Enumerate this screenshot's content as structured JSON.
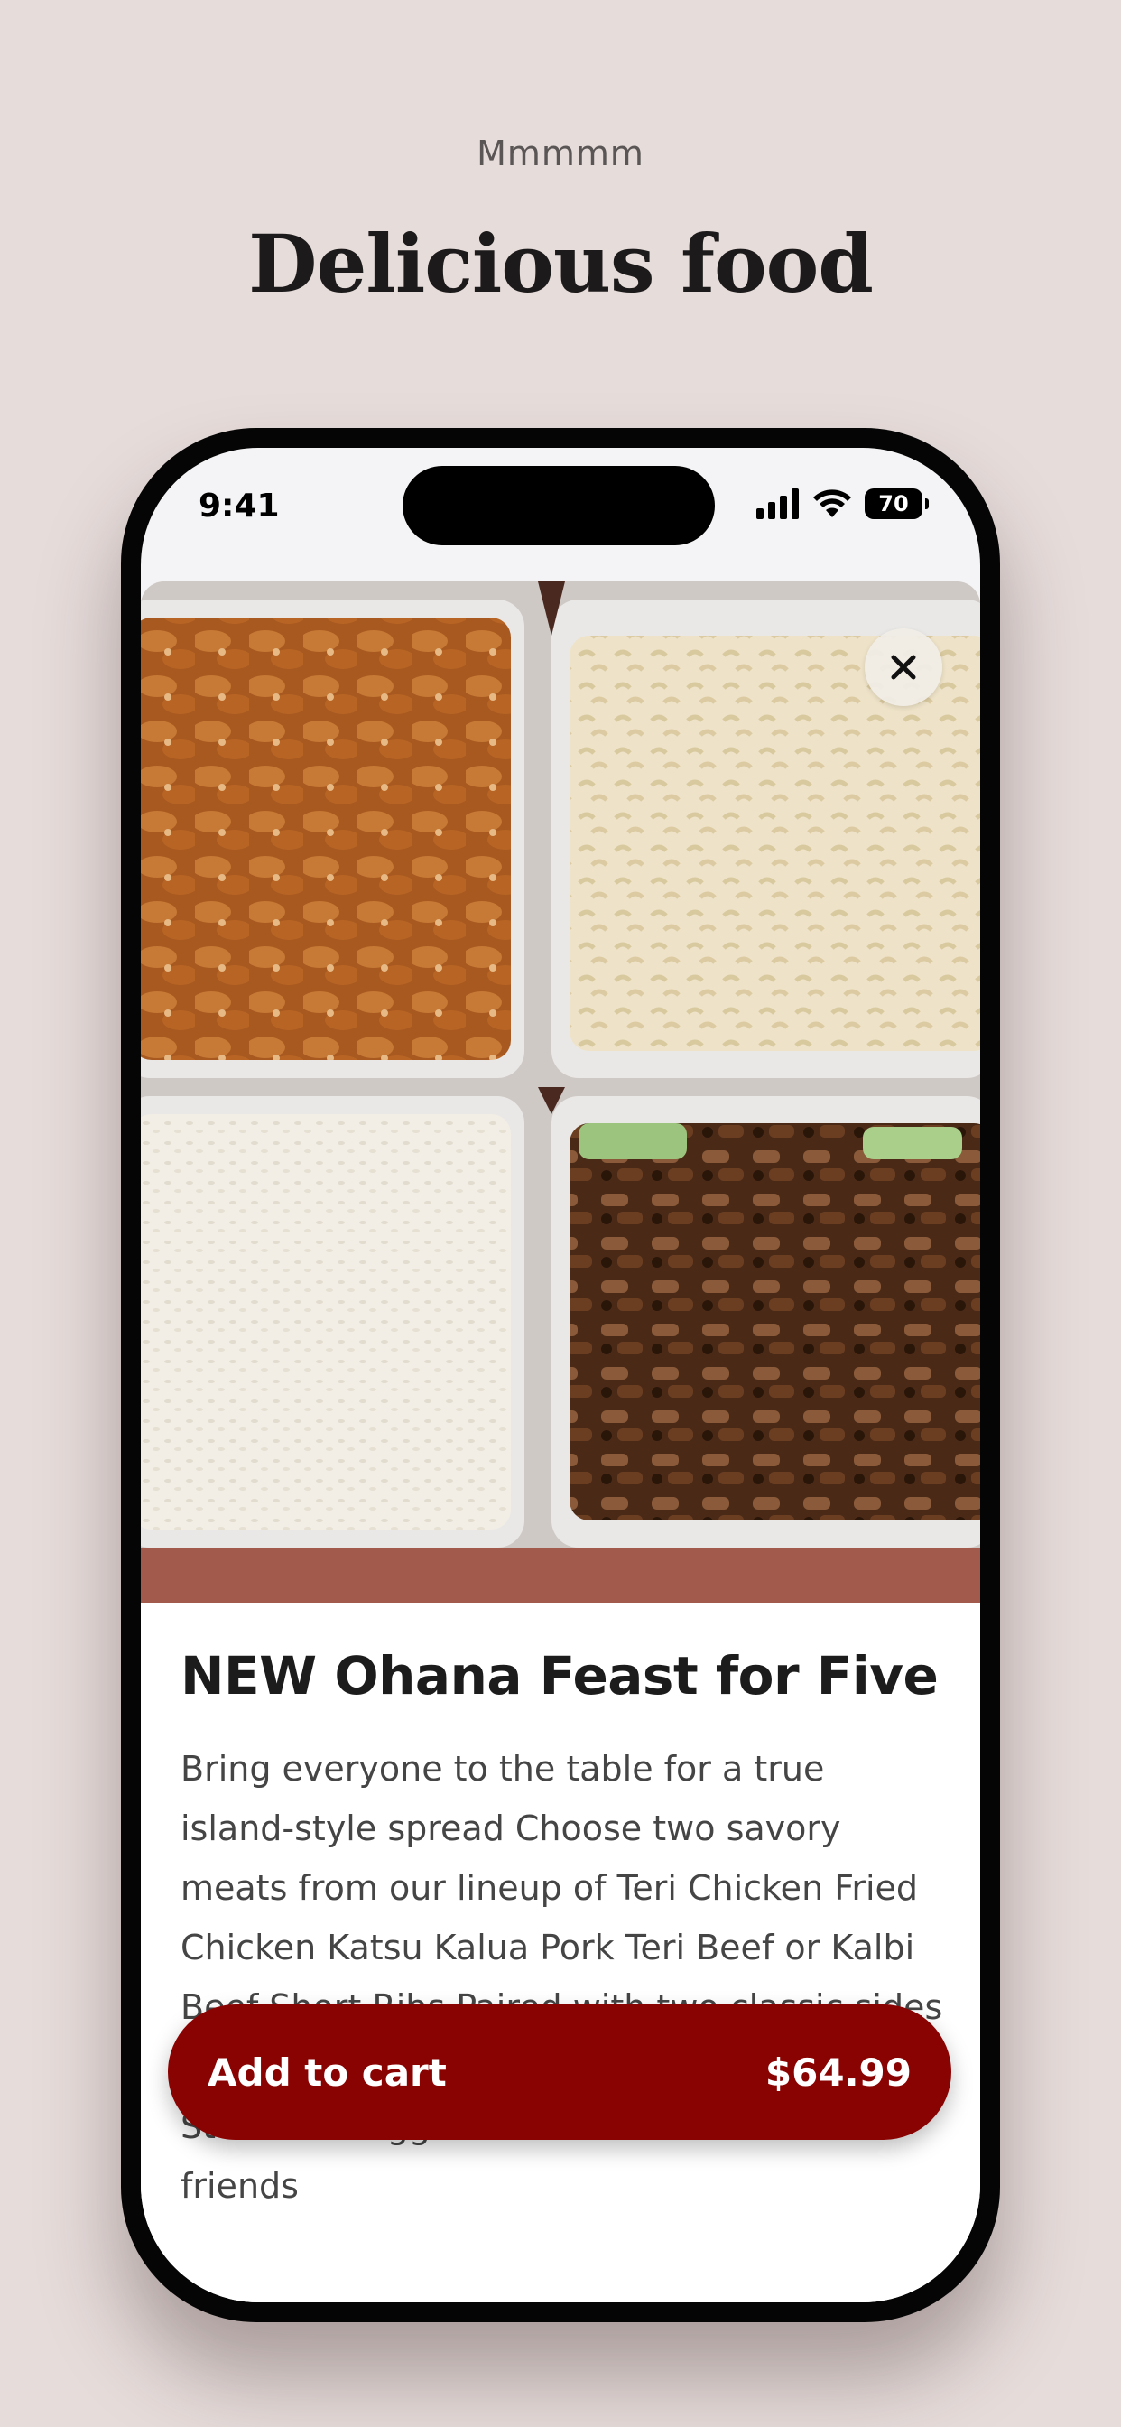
{
  "header": {
    "kicker": "Mmmmm",
    "headline": "Delicious food"
  },
  "status_bar": {
    "time": "9:41",
    "battery": "70",
    "icons": [
      "cellular-signal-icon",
      "wifi-icon",
      "battery-icon"
    ]
  },
  "product": {
    "image": "food-photo",
    "close_icon": "close-icon",
    "title": "NEW Ohana Feast for Five",
    "description": "Bring everyone to the table for a true island-style spread Choose two savory meats from our lineup of Teri Chicken Fried Chicken Katsu Kalua Pork Teri Beef or Kalbi Beef Short Ribs Paired with two classic sides Steamed White Rice Macaroni Salad or Steamed Veggies Perfect for families & friends",
    "add_to_cart_label": "Add to cart",
    "price": "$64.99"
  },
  "colors": {
    "background": "#e6dcda",
    "accent": "#8a0303"
  }
}
